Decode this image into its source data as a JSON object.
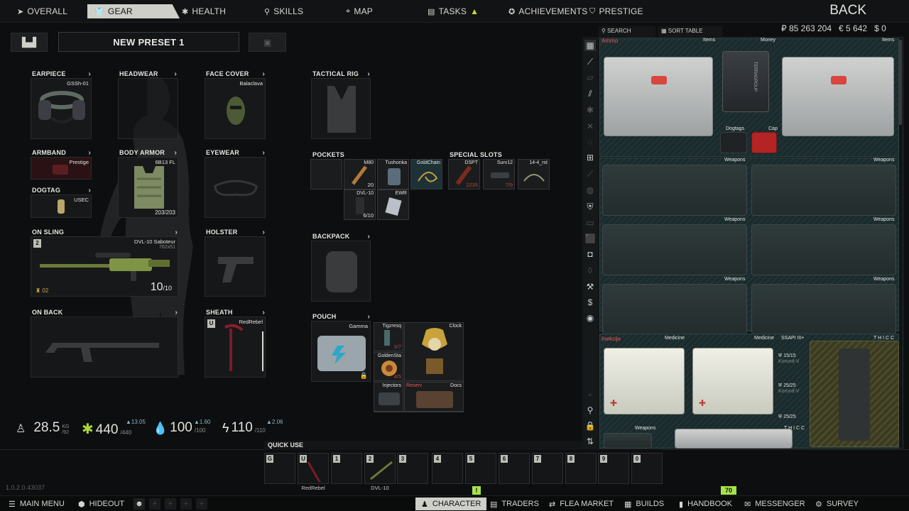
{
  "nav": {
    "tabs": [
      {
        "label": "OVERALL",
        "icon": "arrow-icon"
      },
      {
        "label": "GEAR",
        "icon": "shirt-icon"
      },
      {
        "label": "HEALTH",
        "icon": "cross-icon"
      },
      {
        "label": "SKILLS",
        "icon": "bulb-icon"
      },
      {
        "label": "MAP",
        "icon": "pin-icon"
      },
      {
        "label": "TASKS",
        "icon": "clipboard-icon"
      },
      {
        "label": "ACHIEVEMENTS",
        "icon": "star-icon"
      },
      {
        "label": "PRESTIGE",
        "icon": "badge-icon"
      }
    ],
    "active_tab": "GEAR",
    "back_label": "BACK"
  },
  "preset": {
    "title": "NEW PRESET 1"
  },
  "gear": {
    "earpiece": {
      "label": "EARPIECE",
      "item": "GSSh-01"
    },
    "headwear": {
      "label": "HEADWEAR"
    },
    "face_cover": {
      "label": "FACE COVER",
      "item": "Balaclava"
    },
    "armband": {
      "label": "ARMBAND",
      "item": "Prestige"
    },
    "body_armor": {
      "label": "BODY ARMOR",
      "item": "6B13 FL",
      "durability": "203/203"
    },
    "eyewear": {
      "label": "EYEWEAR"
    },
    "dogtag": {
      "label": "DOGTAG",
      "item": "USEC"
    },
    "on_sling": {
      "label": "ON SLING",
      "item": "DVL-10 Saboteur",
      "caliber": "762x51",
      "ammo": "10",
      "ammo_max": "/10",
      "key": "2",
      "level": "02"
    },
    "holster": {
      "label": "HOLSTER"
    },
    "on_back": {
      "label": "ON BACK"
    },
    "sheath": {
      "label": "SHEATH",
      "item": "RedRebel",
      "key": "U"
    },
    "tactical_rig": {
      "label": "TACTICAL RIG"
    },
    "pockets": {
      "label": "POCKETS",
      "items": [
        {
          "tag": "",
          "count": ""
        },
        {
          "tag": "M80",
          "count": "20"
        },
        {
          "tag": "Tushonka",
          "count": ""
        },
        {
          "tag": "GoldChain",
          "count": ""
        },
        {
          "tag": "DVL-10",
          "count": "6/10"
        },
        {
          "tag": "EWR",
          "count": ""
        }
      ]
    },
    "special_slots": {
      "label": "SPECIAL SLOTS",
      "items": [
        {
          "tag": "DSPT",
          "count": "2235",
          "count_red": true
        },
        {
          "tag": "Surv12",
          "count": "7/9",
          "count_red": true
        },
        {
          "tag": "14-4_rst",
          "count": ""
        }
      ]
    },
    "backpack": {
      "label": "BACKPACK"
    },
    "pouch": {
      "label": "POUCH",
      "container": "Gamma",
      "items": [
        {
          "tag": "Tigzresq",
          "count": "3/7"
        },
        {
          "tag": "GoldenSta",
          "count": "4/5"
        },
        {
          "tag": "Clock",
          "count": ""
        },
        {
          "tag": "Injectors",
          "count": ""
        },
        {
          "tag": "Reserv",
          "count": ""
        },
        {
          "tag": "Docs",
          "count": ""
        }
      ]
    }
  },
  "stats": {
    "weight": {
      "value": "28.5",
      "unit": "KG",
      "max": "/92"
    },
    "energy": {
      "value": "440",
      "max": "/440",
      "rate": "13.05"
    },
    "hydration": {
      "value": "100",
      "max": "/100",
      "rate": "1.60"
    },
    "stamina": {
      "value": "110",
      "max": "/110",
      "rate": "2.06"
    }
  },
  "quick_use": {
    "label": "QUICK USE",
    "slots": [
      {
        "key": "G",
        "name": ""
      },
      {
        "key": "U",
        "name": "RedRebel"
      },
      {
        "key": "1",
        "name": ""
      },
      {
        "key": "2",
        "name": "DVL-10"
      },
      {
        "key": "3",
        "name": ""
      },
      {
        "key": "4",
        "name": ""
      },
      {
        "key": "5",
        "name": ""
      },
      {
        "key": "6",
        "name": ""
      },
      {
        "key": "7",
        "name": ""
      },
      {
        "key": "8",
        "name": ""
      },
      {
        "key": "9",
        "name": ""
      },
      {
        "key": "0",
        "name": ""
      }
    ]
  },
  "version": "1.0.2.0.43037",
  "bottom": {
    "items": [
      {
        "label": "MAIN MENU",
        "icon": "menu-icon"
      },
      {
        "label": "HIDEOUT",
        "icon": "hideout-icon"
      },
      {
        "label": "CHARACTER",
        "icon": "character-icon"
      },
      {
        "label": "TRADERS",
        "icon": "traders-icon"
      },
      {
        "label": "FLEA MARKET",
        "icon": "flea-icon"
      },
      {
        "label": "BUILDS",
        "icon": "builds-icon"
      },
      {
        "label": "HANDBOOK",
        "icon": "handbook-icon"
      },
      {
        "label": "MESSENGER",
        "icon": "messenger-icon"
      },
      {
        "label": "SURVEY",
        "icon": "survey-icon"
      }
    ],
    "badge_character": "!",
    "badge_messenger": "70"
  },
  "stash": {
    "search_label": "SEARCH",
    "sort_label": "SORT TABLE",
    "roubles": "₽ 85 263 204",
    "euros": "€ 5 642",
    "dollars": "$ 0",
    "tags": {
      "ammo": "Ammo",
      "items1": "Items",
      "money": "Money",
      "items2": "Items",
      "dogtags": "Dogtags",
      "cap": "Cap",
      "weapons": "Weapons",
      "inekcije": "Inekcije",
      "medicine": "Medicine",
      "ssapi": "SSAPI III+",
      "thicc": "T H I C C",
      "count1": "15/15",
      "count2": "25/25",
      "count3": "25/25",
      "korund": "Korund-V",
      "terragroup": "TERRAGROUP"
    }
  }
}
